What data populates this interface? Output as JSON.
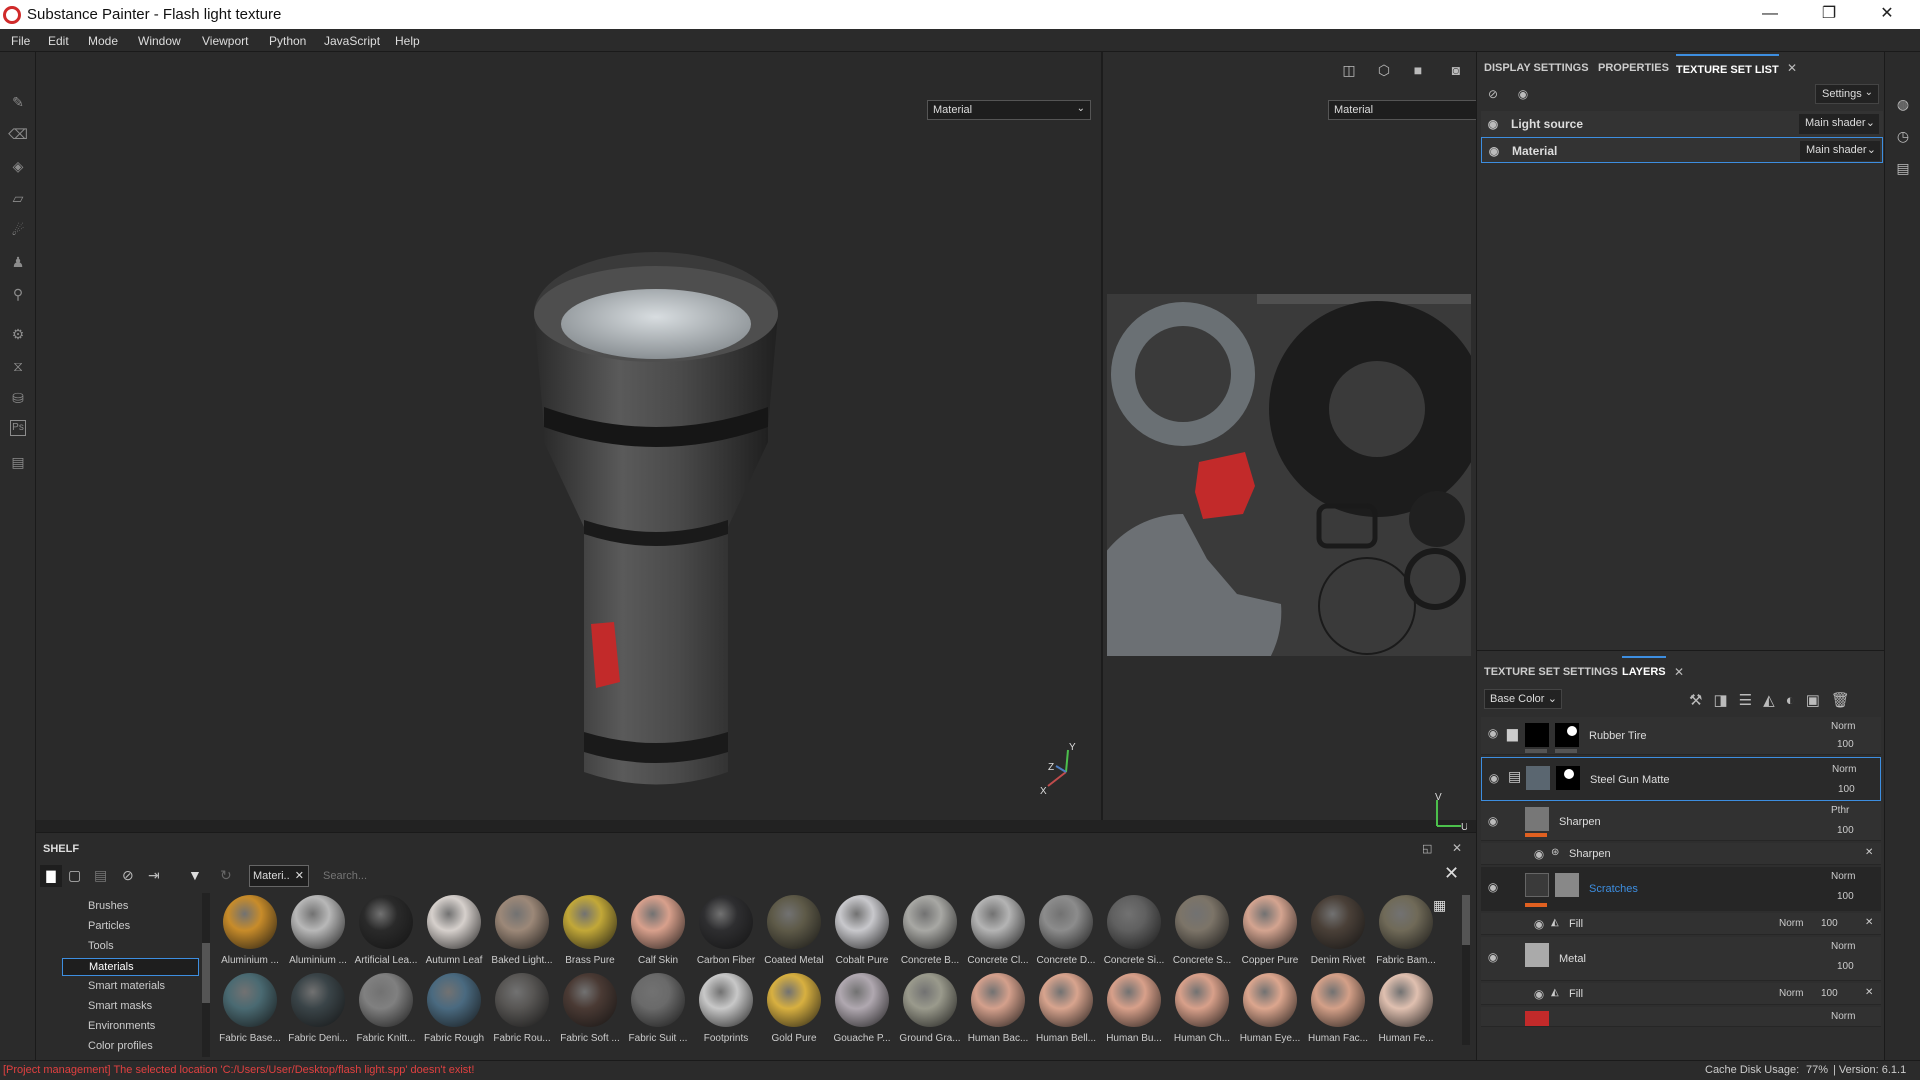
{
  "window": {
    "title": "Substance Painter - Flash light texture",
    "minimize": "—",
    "maximize": "❐",
    "close": "✕"
  },
  "menu": [
    "File",
    "Edit",
    "Mode",
    "Window",
    "Viewport",
    "Python",
    "JavaScript",
    "Help"
  ],
  "viewport": {
    "left_channel": "Material",
    "right_channel": "Material",
    "axis_y": "Y",
    "axis_z": "Z",
    "axis_x": "X",
    "uv_v": "V",
    "uv_u": "U"
  },
  "shelf": {
    "title": "SHELF",
    "filter_tag": "Materi..",
    "search_placeholder": "Search...",
    "categories": [
      "Brushes",
      "Particles",
      "Tools",
      "Materials",
      "Smart materials",
      "Smart masks",
      "Environments",
      "Color profiles"
    ],
    "selected_category": "Materials",
    "row1": [
      {
        "name": "Aluminium ...",
        "color": "#c88c2a"
      },
      {
        "name": "Aluminium ...",
        "color": "#b8b8b8"
      },
      {
        "name": "Artificial Lea...",
        "color": "#2a2a2a"
      },
      {
        "name": "Autumn Leaf",
        "color": "#d6d0cc"
      },
      {
        "name": "Baked Light...",
        "color": "#9c8878"
      },
      {
        "name": "Brass Pure",
        "color": "#c2a838"
      },
      {
        "name": "Calf Skin",
        "color": "#d8a08c"
      },
      {
        "name": "Carbon Fiber",
        "color": "#2e2e30"
      },
      {
        "name": "Coated Metal",
        "color": "#5e5a48"
      },
      {
        "name": "Cobalt Pure",
        "color": "#c8c8cc"
      },
      {
        "name": "Concrete B...",
        "color": "#a8a8a4"
      },
      {
        "name": "Concrete Cl...",
        "color": "#b4b4b4"
      },
      {
        "name": "Concrete D...",
        "color": "#8c8c8c"
      },
      {
        "name": "Concrete Si...",
        "color": "#606060"
      },
      {
        "name": "Concrete S...",
        "color": "#7c7468"
      },
      {
        "name": "Copper Pure",
        "color": "#d4a490"
      },
      {
        "name": "Denim Rivet",
        "color": "#4a4038"
      },
      {
        "name": "Fabric Bam...",
        "color": "#706a58"
      }
    ],
    "row2": [
      {
        "name": "Fabric Base...",
        "color": "#4a6a72"
      },
      {
        "name": "Fabric Deni...",
        "color": "#3a4448"
      },
      {
        "name": "Fabric Knitt...",
        "color": "#808080"
      },
      {
        "name": "Fabric Rough",
        "color": "#4a6a80"
      },
      {
        "name": "Fabric Rou...",
        "color": "#585654"
      },
      {
        "name": "Fabric Soft ...",
        "color": "#4a3a34"
      },
      {
        "name": "Fabric Suit ...",
        "color": "#6a6a6a"
      },
      {
        "name": "Footprints",
        "color": "#c8c8c8"
      },
      {
        "name": "Gold Pure",
        "color": "#d8b040"
      },
      {
        "name": "Gouache P...",
        "color": "#b0a8b0"
      },
      {
        "name": "Ground Gra...",
        "color": "#9a9a8c"
      },
      {
        "name": "Human Bac...",
        "color": "#d4a08c"
      },
      {
        "name": "Human Bell...",
        "color": "#d8a48e"
      },
      {
        "name": "Human Bu...",
        "color": "#d8a08a"
      },
      {
        "name": "Human Ch...",
        "color": "#d8a08a"
      },
      {
        "name": "Human Eye...",
        "color": "#dca68e"
      },
      {
        "name": "Human Fac...",
        "color": "#d4a088"
      },
      {
        "name": "Human Fe...",
        "color": "#e0c0b0"
      }
    ]
  },
  "texture_set_panel": {
    "tabs": [
      "DISPLAY SETTINGS",
      "PROPERTIES",
      "TEXTURE SET LIST"
    ],
    "settings_btn": "Settings",
    "rows": [
      {
        "name": "Light source",
        "shader": "Main shader"
      },
      {
        "name": "Material",
        "shader": "Main shader"
      }
    ]
  },
  "layers_panel": {
    "tabs": [
      "TEXTURE SET SETTINGS",
      "LAYERS"
    ],
    "channel": "Base Color",
    "layers": [
      {
        "name": "Rubber Tire",
        "blend": "Norm",
        "opacity": "100"
      },
      {
        "name": "Steel Gun Matte",
        "blend": "Norm",
        "opacity": "100"
      },
      {
        "name": "Sharpen",
        "blend": "Pthr",
        "opacity": "100"
      },
      {
        "name": "Sharpen",
        "sub": true
      },
      {
        "name": "Scratches",
        "blend": "Norm",
        "opacity": "100"
      },
      {
        "name": "Fill",
        "blend": "Norm",
        "opacity": "100",
        "sub": true
      },
      {
        "name": "Metal",
        "blend": "Norm",
        "opacity": "100"
      },
      {
        "name": "Fill",
        "blend": "Norm",
        "opacity": "100",
        "sub": true
      },
      {
        "name": "",
        "blend": "Norm"
      }
    ]
  },
  "status": {
    "message": "[Project management] The selected location 'C:/Users/User/Desktop/flash light.spp' doesn't exist!",
    "cache": "Cache Disk Usage:",
    "cache_val": "77%",
    "version": "| Version: 6.1.1"
  },
  "colors": {
    "accent": "#3d8ee0",
    "error": "#e04040",
    "orange": "#e06020"
  }
}
